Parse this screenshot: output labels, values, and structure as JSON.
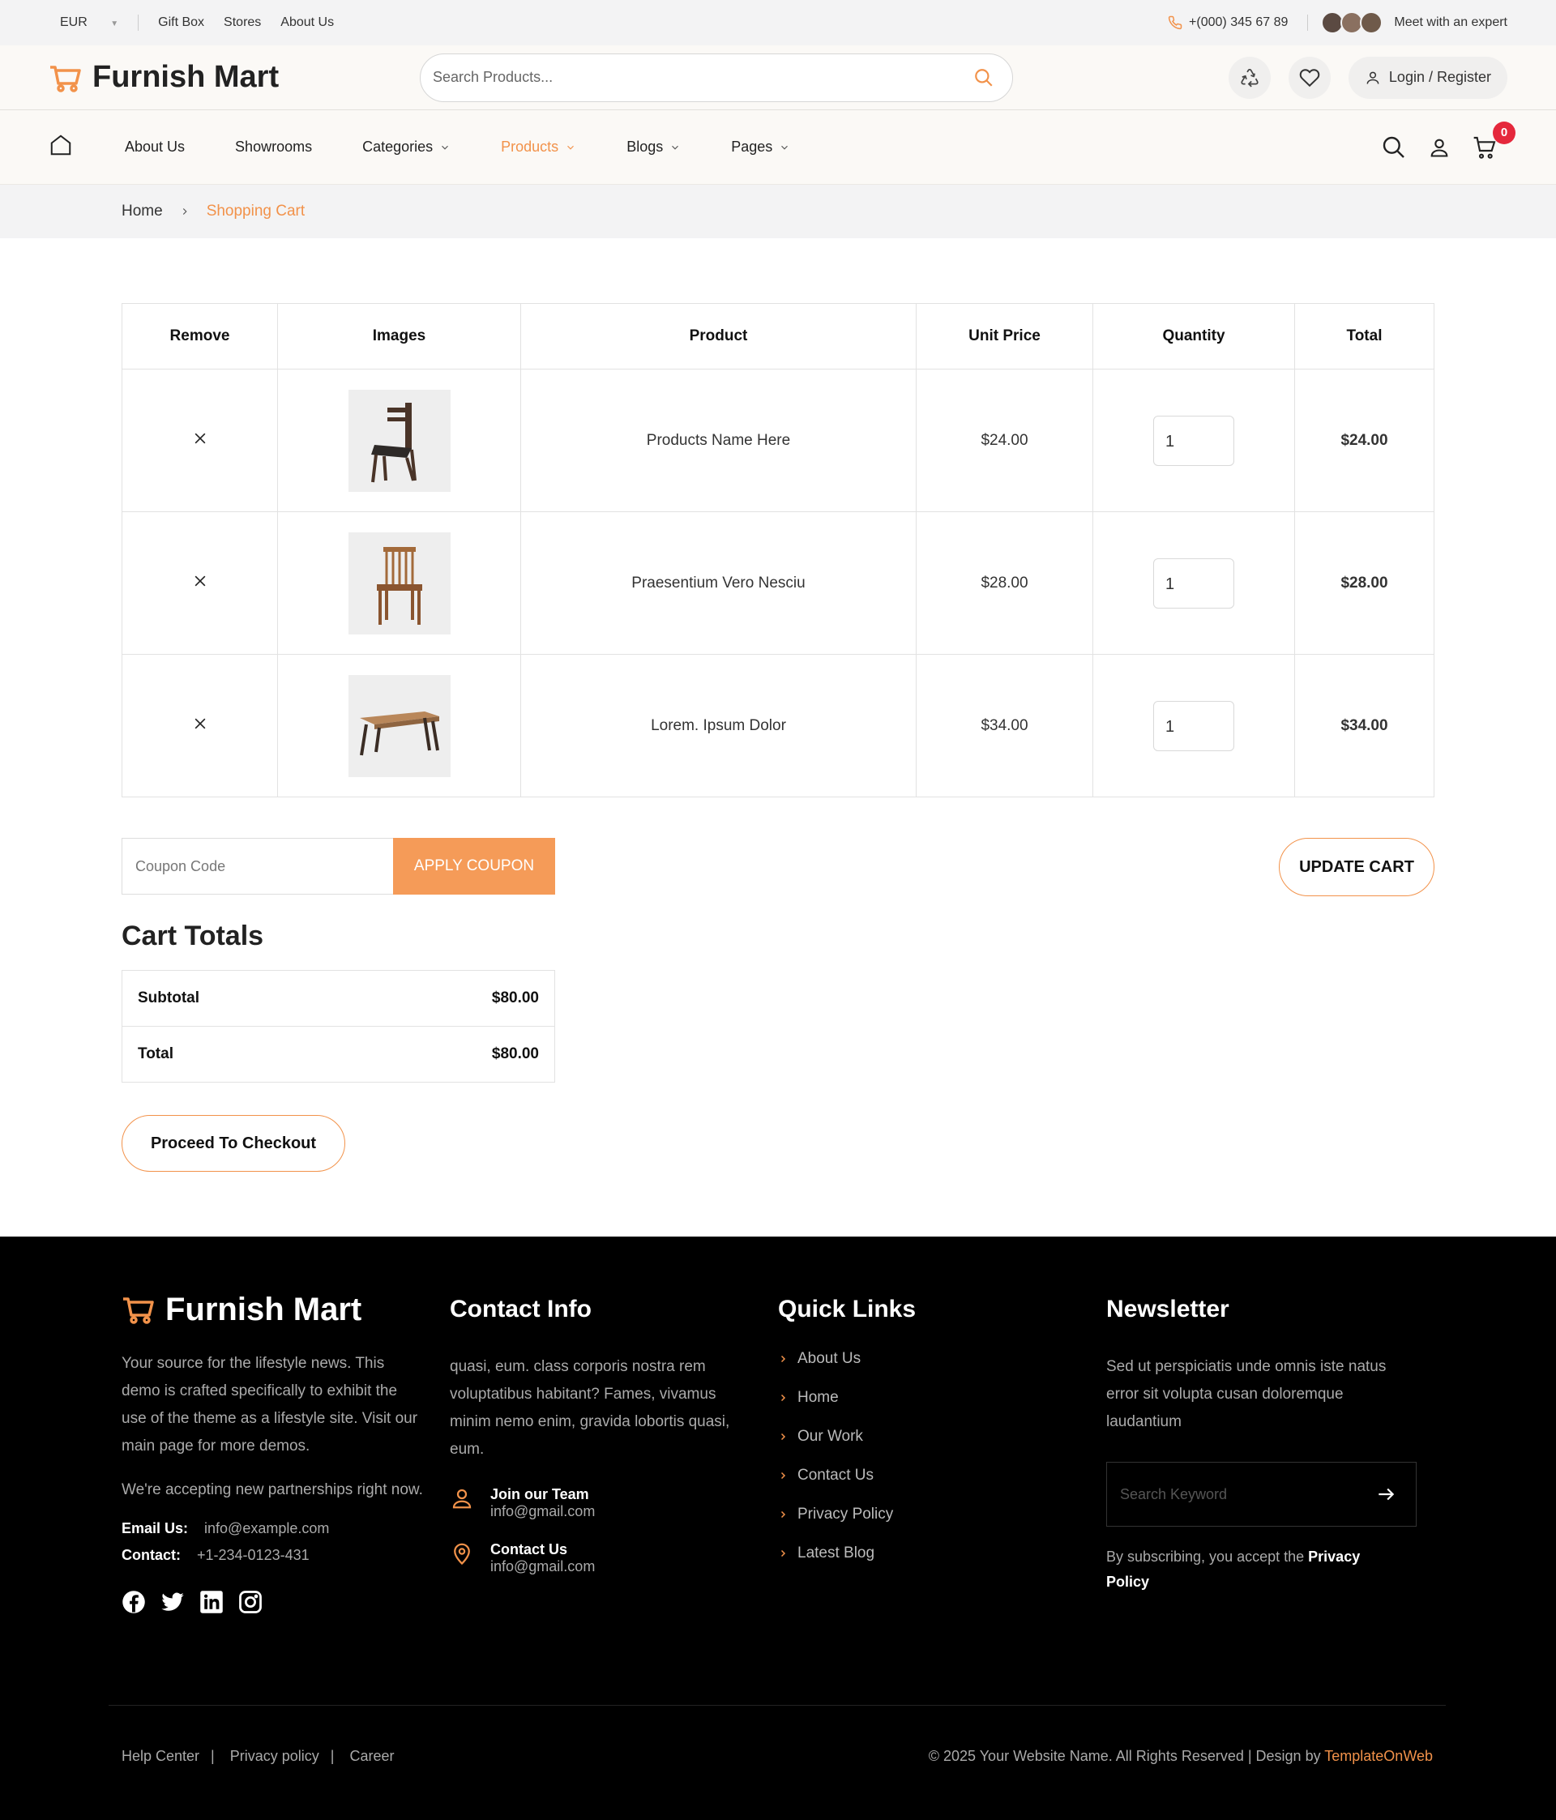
{
  "topbar": {
    "currency": "EUR",
    "links": [
      "Gift Box",
      "Stores",
      "About Us"
    ],
    "phone": "+(000) 345 67 89",
    "expert": "Meet with an expert"
  },
  "header": {
    "brand": "Furnish Mart",
    "search_placeholder": "Search Products...",
    "login": "Login / Register"
  },
  "nav": {
    "items": [
      "About Us",
      "Showrooms",
      "Categories",
      "Products",
      "Blogs",
      "Pages"
    ],
    "cart_count": "0"
  },
  "breadcrumb": {
    "home": "Home",
    "current": "Shopping Cart"
  },
  "cart": {
    "headers": [
      "Remove",
      "Images",
      "Product",
      "Unit Price",
      "Quantity",
      "Total"
    ],
    "rows": [
      {
        "name": "Products Name Here",
        "price": "$24.00",
        "qty": "1",
        "total": "$24.00"
      },
      {
        "name": "Praesentium Vero Nesciu",
        "price": "$28.00",
        "qty": "1",
        "total": "$28.00"
      },
      {
        "name": "Lorem. Ipsum Dolor",
        "price": "$34.00",
        "qty": "1",
        "total": "$34.00"
      }
    ]
  },
  "coupon": {
    "placeholder": "Coupon Code",
    "apply": "APPLY COUPON",
    "update": "UPDATE CART"
  },
  "totals": {
    "title": "Cart Totals",
    "subtotal_label": "Subtotal",
    "subtotal": "$80.00",
    "total_label": "Total",
    "total": "$80.00",
    "checkout": "Proceed To Checkout"
  },
  "footer": {
    "brand": "Furnish Mart",
    "about1": "Your source for the lifestyle news. This demo is crafted specifically to exhibit the use of the theme as a lifestyle site. Visit our main page for more demos.",
    "about2": "We're accepting new partnerships right now.",
    "email_label": "Email Us:",
    "email": "info@example.com",
    "contact_label": "Contact:",
    "contact": "+1-234-0123-431",
    "contact_title": "Contact Info",
    "contact_text": "quasi, eum. class corporis nostra rem voluptatibus habitant? Fames, vivamus minim nemo enim, gravida lobortis quasi, eum.",
    "join_title": "Join our Team",
    "join_email": "info@gmail.com",
    "cu_title": "Contact Us",
    "cu_email": "info@gmail.com",
    "quick_title": "Quick Links",
    "quick": [
      "About Us",
      "Home",
      "Our Work",
      "Contact Us",
      "Privacy Policy",
      "Latest Blog"
    ],
    "news_title": "Newsletter",
    "news_text": "Sed ut perspiciatis unde omnis iste natus error sit volupta cusan doloremque laudantium",
    "news_placeholder": "Search Keyword",
    "news_note": "By subscribing, you accept the",
    "news_policy": "Privacy Policy",
    "bottom_links": [
      "Help Center",
      "Privacy policy",
      "Career"
    ],
    "copyright": "© 2025 Your Website Name. All Rights Reserved | Design by",
    "designer": "TemplateOnWeb"
  },
  "colors": {
    "accent": "#f2924a",
    "badge": "#e5283c"
  }
}
